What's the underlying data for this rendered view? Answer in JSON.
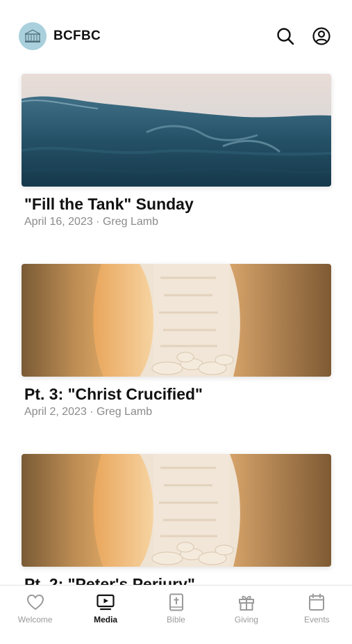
{
  "header": {
    "title": "BCFBC"
  },
  "feed": {
    "items": [
      {
        "title": "\"Fill the Tank\" Sunday",
        "meta": "April 16, 2023 · Greg Lamb"
      },
      {
        "title": "Pt. 3: \"Christ Crucified\"",
        "meta": "April 2, 2023 · Greg Lamb"
      },
      {
        "title": "Pt. 2: \"Peter's Perjury\"",
        "meta": ""
      }
    ]
  },
  "tabs": [
    {
      "label": "Welcome",
      "icon": "heart-icon",
      "active": false
    },
    {
      "label": "Media",
      "icon": "tv-play-icon",
      "active": true
    },
    {
      "label": "Bible",
      "icon": "bible-icon",
      "active": false
    },
    {
      "label": "Giving",
      "icon": "gift-icon",
      "active": false
    },
    {
      "label": "Events",
      "icon": "calendar-icon",
      "active": false
    }
  ],
  "colors": {
    "active_tab": "#111111",
    "inactive_tab": "#9a9a9a",
    "meta_text": "#8a8a8a",
    "logo_bg": "#a9d0dc"
  }
}
